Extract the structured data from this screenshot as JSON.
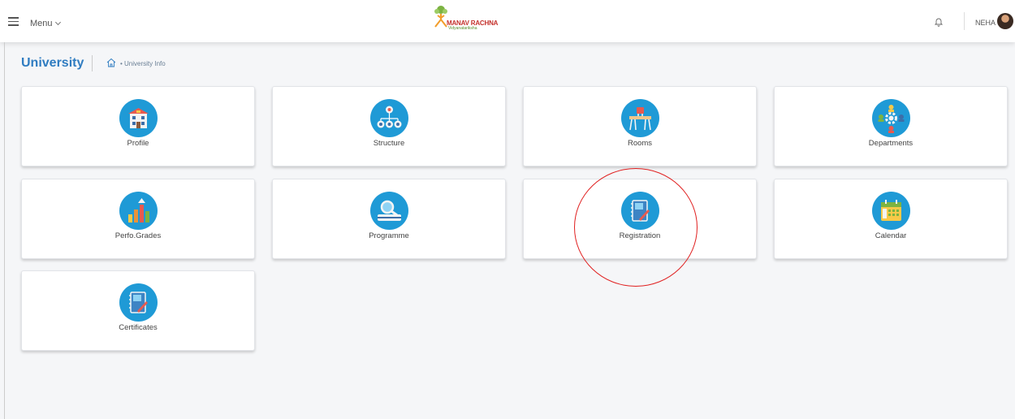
{
  "header": {
    "menu_label": "Menu",
    "logo_brand": "MANAV RACHNA",
    "logo_tagline": "Vidyanatariksha",
    "user_name": "NEHA"
  },
  "page": {
    "title": "University",
    "breadcrumb": "• University Info"
  },
  "tiles": [
    {
      "label": "Profile",
      "icon": "building-icon"
    },
    {
      "label": "Structure",
      "icon": "hierarchy-icon"
    },
    {
      "label": "Rooms",
      "icon": "classroom-icon"
    },
    {
      "label": "Departments",
      "icon": "departments-gear-icon"
    },
    {
      "label": "Perfo.Grades",
      "icon": "bar-chart-icon"
    },
    {
      "label": "Programme",
      "icon": "programme-search-icon"
    },
    {
      "label": "Registration",
      "icon": "notebook-pen-icon"
    },
    {
      "label": "Calendar",
      "icon": "calendar-icon"
    },
    {
      "label": "Certificates",
      "icon": "certificate-notebook-icon"
    }
  ],
  "colors": {
    "accent": "#2f7cc1",
    "icon_bg": "#1f9ad6",
    "annotation": "#e02020"
  }
}
